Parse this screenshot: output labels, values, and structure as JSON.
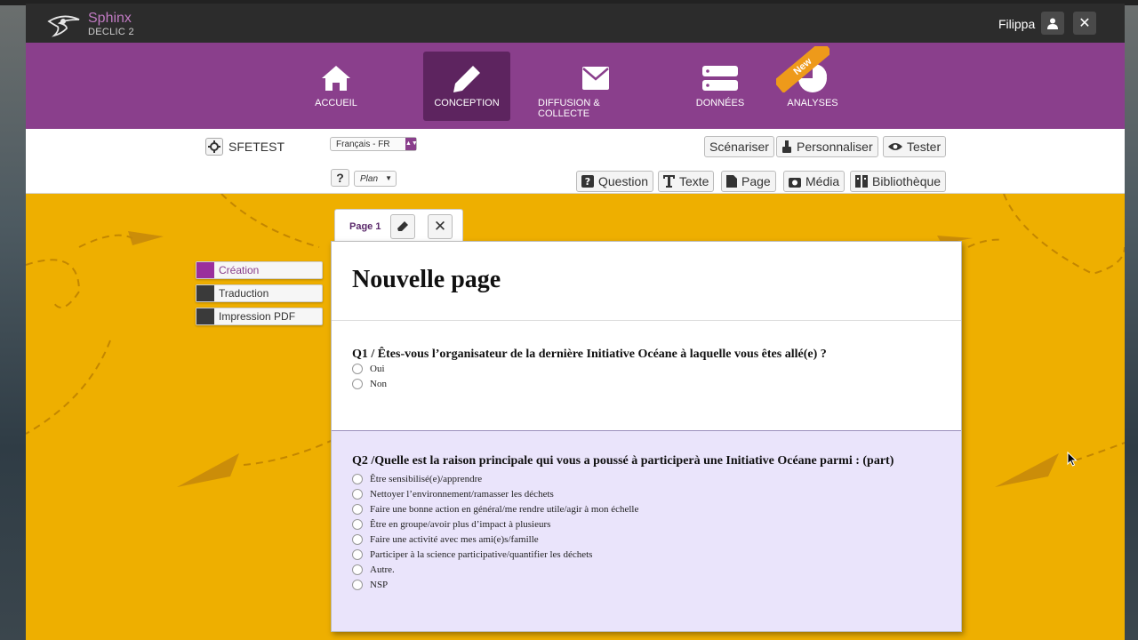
{
  "app": {
    "logo_name": "Sphinx",
    "logo_sub": "DECLIC 2",
    "user": "Filippa"
  },
  "nav": {
    "items": [
      {
        "label": "ACCUEIL",
        "icon": "home-icon"
      },
      {
        "label": "CONCEPTION",
        "icon": "pencil-icon",
        "active": true
      },
      {
        "label": "DIFFUSION & COLLECTE",
        "icon": "envelope-icon"
      },
      {
        "label": "DONNÉES",
        "icon": "server-icon"
      },
      {
        "label": "ANALYSES",
        "icon": "pie-chart-icon",
        "badge": "New"
      }
    ]
  },
  "toolbar": {
    "project": "SFETEST",
    "language": "Français - FR",
    "help": "?",
    "view": "Plan",
    "top_buttons": [
      "Scénariser",
      "Personnaliser",
      "Tester"
    ],
    "insert_buttons": [
      "Question",
      "Texte",
      "Page",
      "Média",
      "Bibliothèque"
    ]
  },
  "side": {
    "items": [
      {
        "label": "Création",
        "color": "#9a2f9d"
      },
      {
        "label": "Traduction",
        "color": "#3a3a3a"
      },
      {
        "label": "Impression PDF",
        "color": "#3a3a3a"
      }
    ]
  },
  "page": {
    "tab": "Page 1",
    "title": "Nouvelle page",
    "q1": {
      "title": "Q1 / Êtes-vous l’organisateur de la dernière Initiative Océane à laquelle vous êtes allé(e) ?",
      "options": [
        "Oui",
        "Non"
      ]
    },
    "q2": {
      "title": "Q2 /Quelle est la raison principale qui vous a poussé à participerà une Initiative Océane parmi : (part)",
      "options": [
        "Être sensibilisé(e)/apprendre",
        "Nettoyer l’environnement/ramasser les déchets",
        "Faire une bonne action en général/me rendre utile/agir à mon échelle",
        "Être en groupe/avoir plus d’impact à plusieurs",
        "Faire une activité avec mes ami(e)s/famille",
        "Participer à la science participative/quantifier les déchets",
        "Autre.",
        "NSP"
      ]
    }
  },
  "colors": {
    "nav_bg": "#8a3f8c",
    "nav_active": "#5d245f",
    "canvas": "#eeaf00",
    "q2_bg": "#eae4fb"
  }
}
